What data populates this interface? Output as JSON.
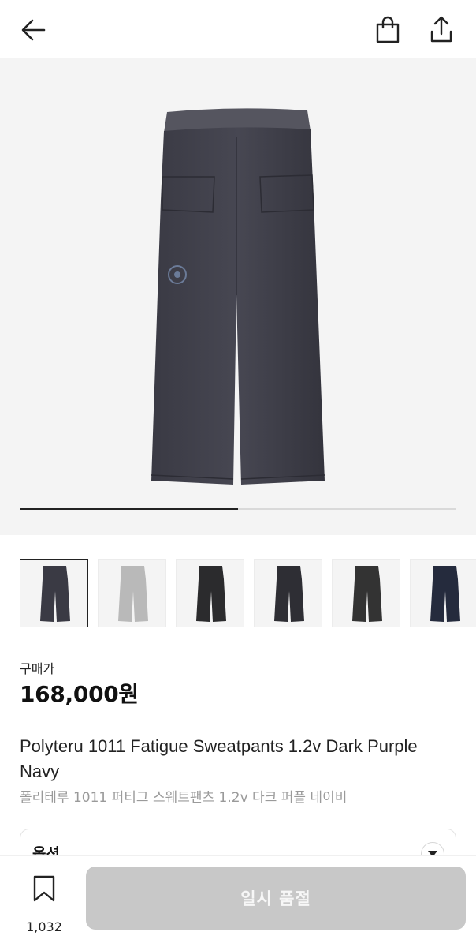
{
  "header": {
    "back_icon": "arrow-left-icon",
    "bag_icon": "shopping-bag-icon",
    "share_icon": "share-upload-icon"
  },
  "gallery": {
    "progress": 0.5,
    "thumbnails": [
      {
        "color": "#3a3a44",
        "selected": true
      },
      {
        "color": "#b9b9b9",
        "selected": false
      },
      {
        "color": "#2b2b2d",
        "selected": false
      },
      {
        "color": "#2e2e34",
        "selected": false
      },
      {
        "color": "#333333",
        "selected": false
      },
      {
        "color": "#252b3d",
        "selected": false
      }
    ]
  },
  "product": {
    "price_label": "구매가",
    "price": "168,000원",
    "name_en": "Polyteru 1011 Fatigue Sweatpants 1.2v Dark Purple Navy",
    "name_ko": "폴리테루 1011 퍼티그 스웨트팬츠 1.2v 다크 퍼플 네이비"
  },
  "option": {
    "label": "옵션",
    "toggle_icon": "chevron-down-icon"
  },
  "bottom": {
    "like_icon": "bookmark-icon",
    "like_count": "1,032",
    "soldout_label": "일시 품절"
  },
  "colors": {
    "pants_main": "#3a3a44",
    "button_disabled": "#c8c8c8",
    "background": "#f4f4f4"
  }
}
